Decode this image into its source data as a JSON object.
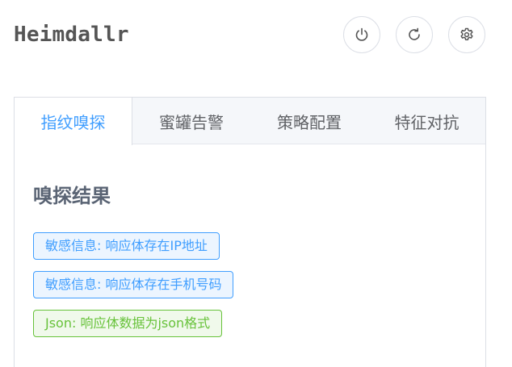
{
  "header": {
    "title": "Heimdallr",
    "buttons": [
      {
        "name": "power",
        "icon": "power-icon"
      },
      {
        "name": "refresh",
        "icon": "refresh-icon"
      },
      {
        "name": "settings",
        "icon": "gear-icon"
      }
    ]
  },
  "tabs": [
    {
      "label": "指纹嗅探",
      "active": true
    },
    {
      "label": "蜜罐告警",
      "active": false
    },
    {
      "label": "策略配置",
      "active": false
    },
    {
      "label": "特征对抗",
      "active": false
    }
  ],
  "results": {
    "heading": "嗅探结果",
    "tags": [
      {
        "text": "敏感信息: 响应体存在IP地址",
        "color": "#409eff"
      },
      {
        "text": "敏感信息: 响应体存在手机号码",
        "color": "#409eff"
      },
      {
        "text": "Json: 响应体数据为json格式",
        "color": "#67c23a"
      }
    ]
  },
  "colors": {
    "accent": "#409eff",
    "success": "#67c23a",
    "border": "#dcdfe6",
    "tab_bg": "#f5f7fa"
  }
}
